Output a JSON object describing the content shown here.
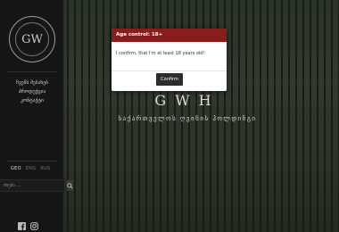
{
  "sidebar": {
    "logo_text": "GW",
    "nav": [
      {
        "label": "ჩვენს შესახებ"
      },
      {
        "label": "პროდუქცია"
      },
      {
        "label": "კონტაქტი"
      }
    ],
    "languages": [
      {
        "code": "GEO",
        "active": true
      },
      {
        "code": "ENG",
        "active": false
      },
      {
        "code": "RUS",
        "active": false
      }
    ],
    "search": {
      "placeholder": "ძიება ..."
    },
    "social": [
      {
        "icon": "facebook-icon"
      },
      {
        "icon": "instagram-icon"
      }
    ]
  },
  "hero": {
    "title": "GWH",
    "subtitle": "საქართველოს ღვინის ჰოლდინგი"
  },
  "modal": {
    "title": "Age control: 18+",
    "message": "I confirm, that I'm at least 18 years old!",
    "confirm_label": "Confirm"
  },
  "colors": {
    "modal_header": "#8a1c1c",
    "confirm_button": "#2c2c2c",
    "sidebar_bg": "#161616"
  }
}
